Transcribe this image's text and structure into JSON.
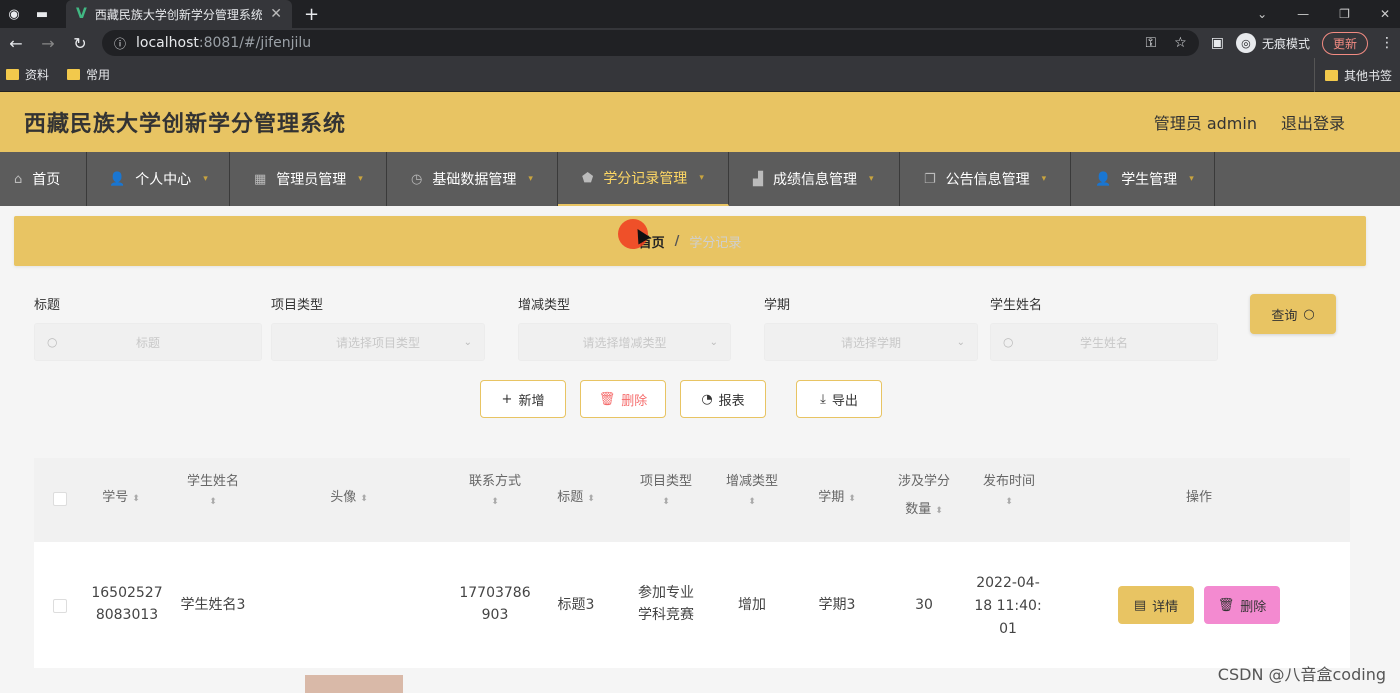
{
  "browser": {
    "tab_title": "西藏民族大学创新学分管理系统",
    "url_host": "localhost",
    "url_path": ":8081/#/jifenjilu",
    "incognito_label": "无痕模式",
    "update_label": "更新",
    "bookmarks": [
      "资料",
      "常用"
    ],
    "bookmarks_right": "其他书签"
  },
  "app": {
    "title": "西藏民族大学创新学分管理系统",
    "user_label": "管理员 admin",
    "logout_label": "退出登录",
    "accent_color": "#e8c463"
  },
  "menu": [
    {
      "label": "首页",
      "icon": "home-icon"
    },
    {
      "label": "个人中心",
      "icon": "user-icon"
    },
    {
      "label": "管理员管理",
      "icon": "grid-icon"
    },
    {
      "label": "基础数据管理",
      "icon": "clock-icon"
    },
    {
      "label": "学分记录管理",
      "icon": "shield-icon"
    },
    {
      "label": "成绩信息管理",
      "icon": "chart-icon"
    },
    {
      "label": "公告信息管理",
      "icon": "copy-icon"
    },
    {
      "label": "学生管理",
      "icon": "user-icon"
    }
  ],
  "breadcrumb": {
    "home": "首页",
    "separator": "/",
    "current": "学分记录"
  },
  "search": {
    "fields": [
      {
        "label": "标题",
        "placeholder": "标题"
      },
      {
        "label": "项目类型",
        "placeholder": "请选择项目类型"
      },
      {
        "label": "增减类型",
        "placeholder": "请选择增减类型"
      },
      {
        "label": "学期",
        "placeholder": "请选择学期"
      },
      {
        "label": "学生姓名",
        "placeholder": "学生姓名"
      }
    ],
    "query_label": "查询"
  },
  "actions": {
    "add": "新增",
    "delete": "删除",
    "report": "报表",
    "export": "导出"
  },
  "table": {
    "headers": {
      "student_no": "学号",
      "student_name": "学生姓名",
      "avatar": "头像",
      "contact": "联系方式",
      "title": "标题",
      "project_type": "项目类型",
      "change_type": "增减类型",
      "term": "学期",
      "credits_1": "涉及学分",
      "credits_2": "数量",
      "publish_time": "发布时间",
      "ops": "操作"
    },
    "rows": [
      {
        "student_no_1": "16502527",
        "student_no_2": "8083013",
        "student_name": "学生姓名3",
        "contact_1": "17703786",
        "contact_2": "903",
        "title": "标题3",
        "project_type_1": "参加专业",
        "project_type_2": "学科竞赛",
        "change_type": "增加",
        "term": "学期3",
        "credits": "30",
        "time_1": "2022-04-",
        "time_2": "18 11:40:",
        "time_3": "01",
        "detail_label": "详情",
        "delete_label": "删除"
      }
    ]
  },
  "watermark": "CSDN @八音盒coding"
}
